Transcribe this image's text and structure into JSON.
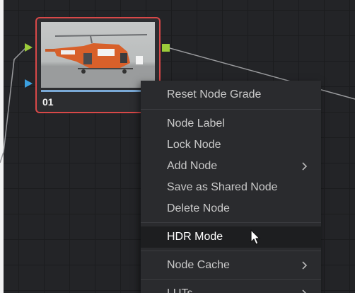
{
  "node": {
    "label": "01",
    "thumbnail": "helicopter-on-tarmac",
    "progress": 1.0,
    "border_color": "#d84848",
    "input_rgb_color": "#9ccc3a",
    "input_alpha_color": "#3ca0e0",
    "output_rgb_color": "#9ccc3a"
  },
  "context_menu": {
    "items": [
      {
        "label": "Reset Node Grade"
      },
      {
        "label": "Node Label"
      },
      {
        "label": "Lock Node"
      },
      {
        "label": "Add Node",
        "submenu": true,
        "icon": "chevron-right-icon"
      },
      {
        "label": "Save as Shared Node"
      },
      {
        "label": "Delete Node"
      },
      {
        "label": "HDR Mode",
        "highlighted": true
      },
      {
        "label": "Node Cache",
        "submenu": true,
        "icon": "chevron-right-icon"
      },
      {
        "label": "LUTs",
        "submenu": true,
        "icon": "chevron-right-icon"
      }
    ]
  },
  "cursor": {
    "icon": "mouse-pointer-icon"
  }
}
